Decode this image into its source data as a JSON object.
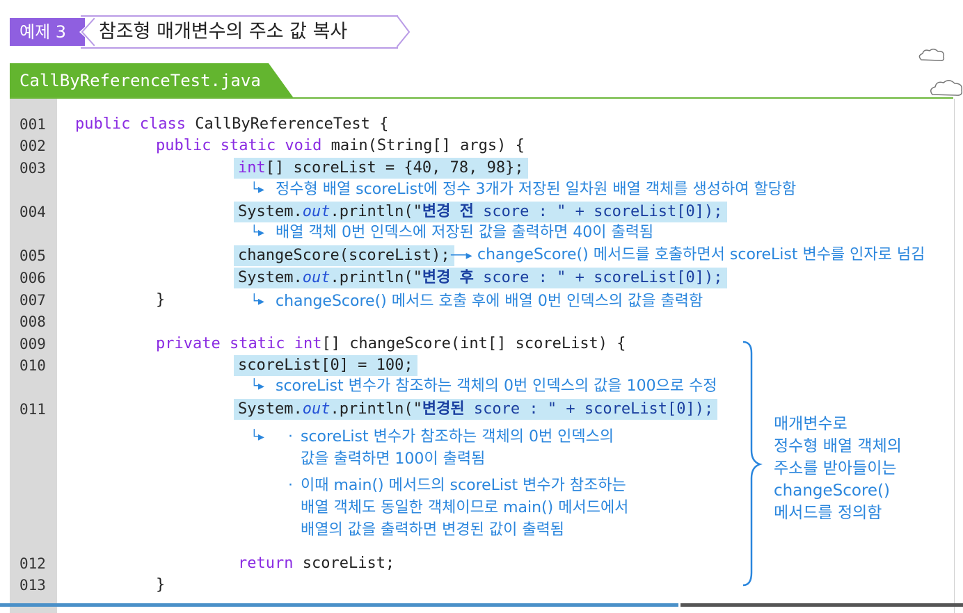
{
  "header": {
    "tag": "예제 3",
    "title": "참조형 매개변수의 주소 값 복사"
  },
  "file": {
    "name": "CallByReferenceTest.java"
  },
  "lines": [
    "001",
    "002",
    "003",
    "004",
    "005",
    "006",
    "007",
    "008",
    "009",
    "010",
    "011",
    "012",
    "013"
  ],
  "code": {
    "l1_kw": "public class",
    "l1_rest": " CallByReferenceTest {",
    "l2_kw": "public static void",
    "l2_rest": " main(String[] args) {",
    "l3_kw": "int",
    "l3_rest": "[] scoreList = {40, 78, 98};",
    "l4_a": "System.",
    "l4_out": "out",
    "l4_b": ".println(\"",
    "l4_ko": "변경 전",
    "l4_c": " score : \" + scoreList[0]);",
    "l5": "changeScore(scoreList);",
    "l6_a": "System.",
    "l6_out": "out",
    "l6_b": ".println(\"",
    "l6_ko": "변경 후",
    "l6_c": " score : \" + scoreList[0]);",
    "l7": "}",
    "l9_kw1": "private",
    "l9_kw2": "static",
    "l9_kw3": "int",
    "l9_rest": "[] changeScore(int[] scoreList) {",
    "l10": "scoreList[0] = 100;",
    "l11_a": "System.",
    "l11_out": "out",
    "l11_b": ".println(\"",
    "l11_ko": "변경된",
    "l11_c": " score : \" + scoreList[0]);",
    "l12_kw": "return",
    "l12_rest": " scoreList;",
    "l13": "}"
  },
  "notes": {
    "n3": "정수형 배열 scoreList에 정수 3개가 저장된 일차원 배열 객체를 생성하여 할당함",
    "n4": "배열 객체 0번 인덱스에 저장된 값을 출력하면 40이 출력됨",
    "n5": "changeScore() 메서드를 호출하면서 scoreList 변수를 인자로 넘김",
    "n7": "changeScore() 메서드 호출 후에 배열 0번 인덱스의 값을 출력함",
    "n10": "scoreList 변수가 참조하는 객체의 0번 인덱스의 값을 100으로 수정",
    "n11a_1": "scoreList 변수가 참조하는 객체의 0번 인덱스의",
    "n11a_2": "값을 출력하면 100이 출력됨",
    "n11b_1": "이때 main() 메서드의 scoreList 변수가 참조하는",
    "n11b_2": "배열 객체도 동일한 객체이므로 main() 메서드에서",
    "n11b_3": "배열의 값을 출력하면 변경된 값이 출력됨"
  },
  "side_note": [
    "매개변수로",
    "정수형 배열 객체의",
    "주소를 받아들이는",
    "changeScore()",
    "메서드를 정의함"
  ],
  "colors": {
    "accent_purple": "#8f5fe0",
    "tab_green": "#63b52f",
    "note_blue": "#2a86dd",
    "highlight": "#c6e7f6"
  }
}
